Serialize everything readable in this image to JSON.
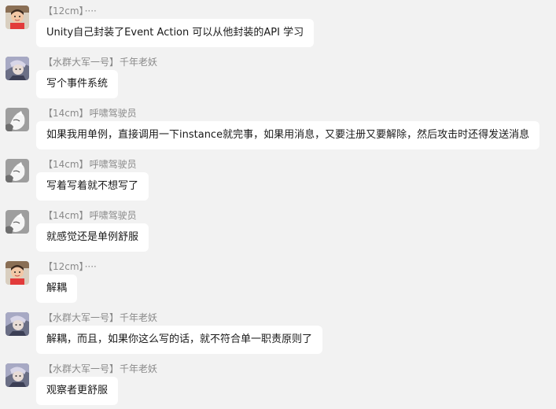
{
  "messages": [
    {
      "avatar": "child-photo-avatar",
      "tag": "【12cm】",
      "nick": "····",
      "text": "Unity自己封装了Event Action 可以从他封装的API 学习"
    },
    {
      "avatar": "anime-character-avatar",
      "tag": "【水群大军一号】",
      "nick": "千年老妖",
      "text": "写个事件系统"
    },
    {
      "avatar": "sketch-figure-avatar",
      "tag": "【14cm】",
      "nick": "呼啸驾驶员",
      "text": "如果我用单例，直接调用一下instance就完事，如果用消息，又要注册又要解除，然后攻击时还得发送消息"
    },
    {
      "avatar": "sketch-figure-avatar",
      "tag": "【14cm】",
      "nick": "呼啸驾驶员",
      "text": "写着写着就不想写了"
    },
    {
      "avatar": "sketch-figure-avatar",
      "tag": "【14cm】",
      "nick": "呼啸驾驶员",
      "text": "就感觉还是单例舒服"
    },
    {
      "avatar": "child-photo-avatar",
      "tag": "【12cm】",
      "nick": "····",
      "text": "解耦"
    },
    {
      "avatar": "anime-character-avatar",
      "tag": "【水群大军一号】",
      "nick": "千年老妖",
      "text": "解耦，而且，如果你这么写的话，就不符合单一职责原则了"
    },
    {
      "avatar": "anime-character-avatar",
      "tag": "【水群大军一号】",
      "nick": "千年老妖",
      "text": "观察者更舒服"
    }
  ]
}
